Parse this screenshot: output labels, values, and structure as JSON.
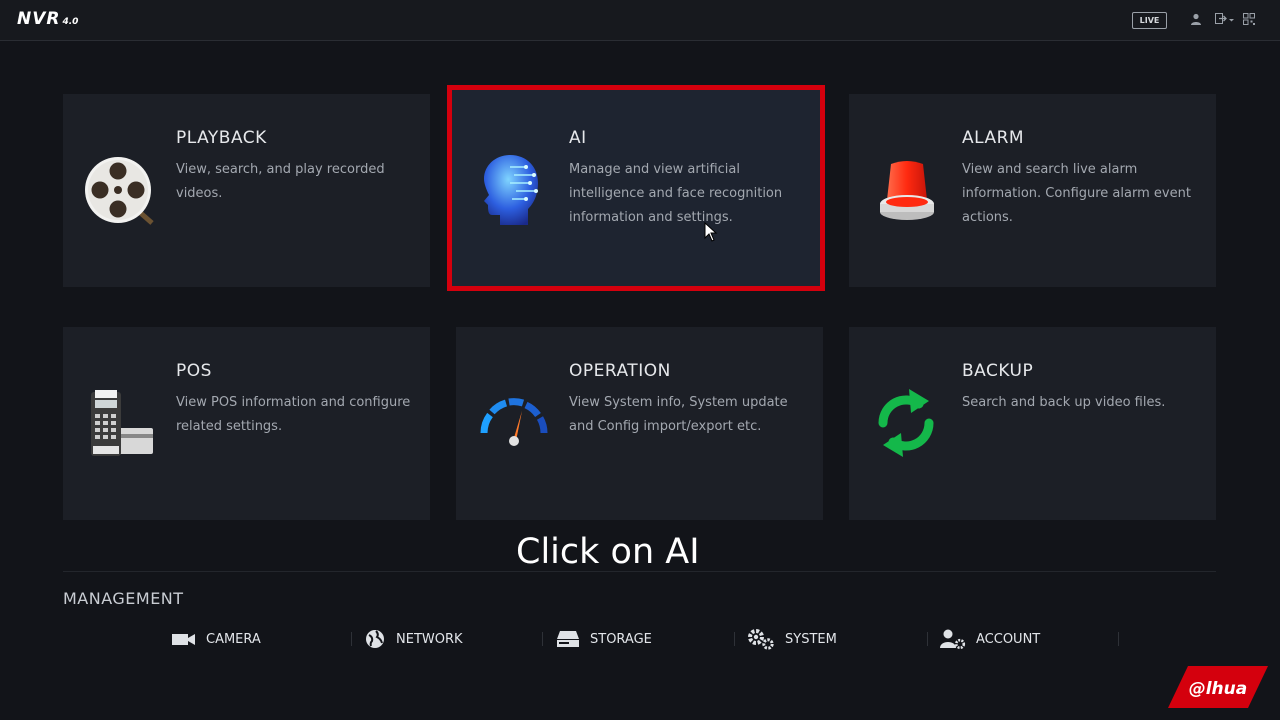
{
  "app": {
    "logo_text": "NVR",
    "logo_version": "4.0"
  },
  "topbar": {
    "live_label": "LIVE"
  },
  "cards": [
    {
      "id": "playback",
      "title": "PLAYBACK",
      "desc": "View, search, and play recorded videos.",
      "icon": "film-reel-icon"
    },
    {
      "id": "ai",
      "title": "AI",
      "desc": "Manage and view artificial intelligence and face recognition information and settings.",
      "icon": "ai-head-icon",
      "selected": true
    },
    {
      "id": "alarm",
      "title": "ALARM",
      "desc": "View and search live alarm information. Configure alarm event actions.",
      "icon": "alarm-siren-icon"
    },
    {
      "id": "pos",
      "title": "POS",
      "desc": "View POS information and configure related settings.",
      "icon": "pos-terminal-icon"
    },
    {
      "id": "operation",
      "title": "OPERATION",
      "desc": "View System info, System update and  Config import/export etc.",
      "icon": "speedometer-icon"
    },
    {
      "id": "backup",
      "title": "BACKUP",
      "desc": "Search and back up video files.",
      "icon": "refresh-arrows-icon"
    }
  ],
  "overlay_caption": "Click on AI",
  "management": {
    "title": "MANAGEMENT",
    "items": [
      {
        "label": "CAMERA",
        "icon": "camera-icon"
      },
      {
        "label": "NETWORK",
        "icon": "globe-icon"
      },
      {
        "label": "STORAGE",
        "icon": "hard-drive-icon"
      },
      {
        "label": "SYSTEM",
        "icon": "gears-icon"
      },
      {
        "label": "ACCOUNT",
        "icon": "user-gear-icon"
      }
    ]
  },
  "brand": {
    "text": "alhua"
  },
  "colors": {
    "selection": "#d4000d",
    "background": "#121419",
    "card": "#1c1f26"
  }
}
